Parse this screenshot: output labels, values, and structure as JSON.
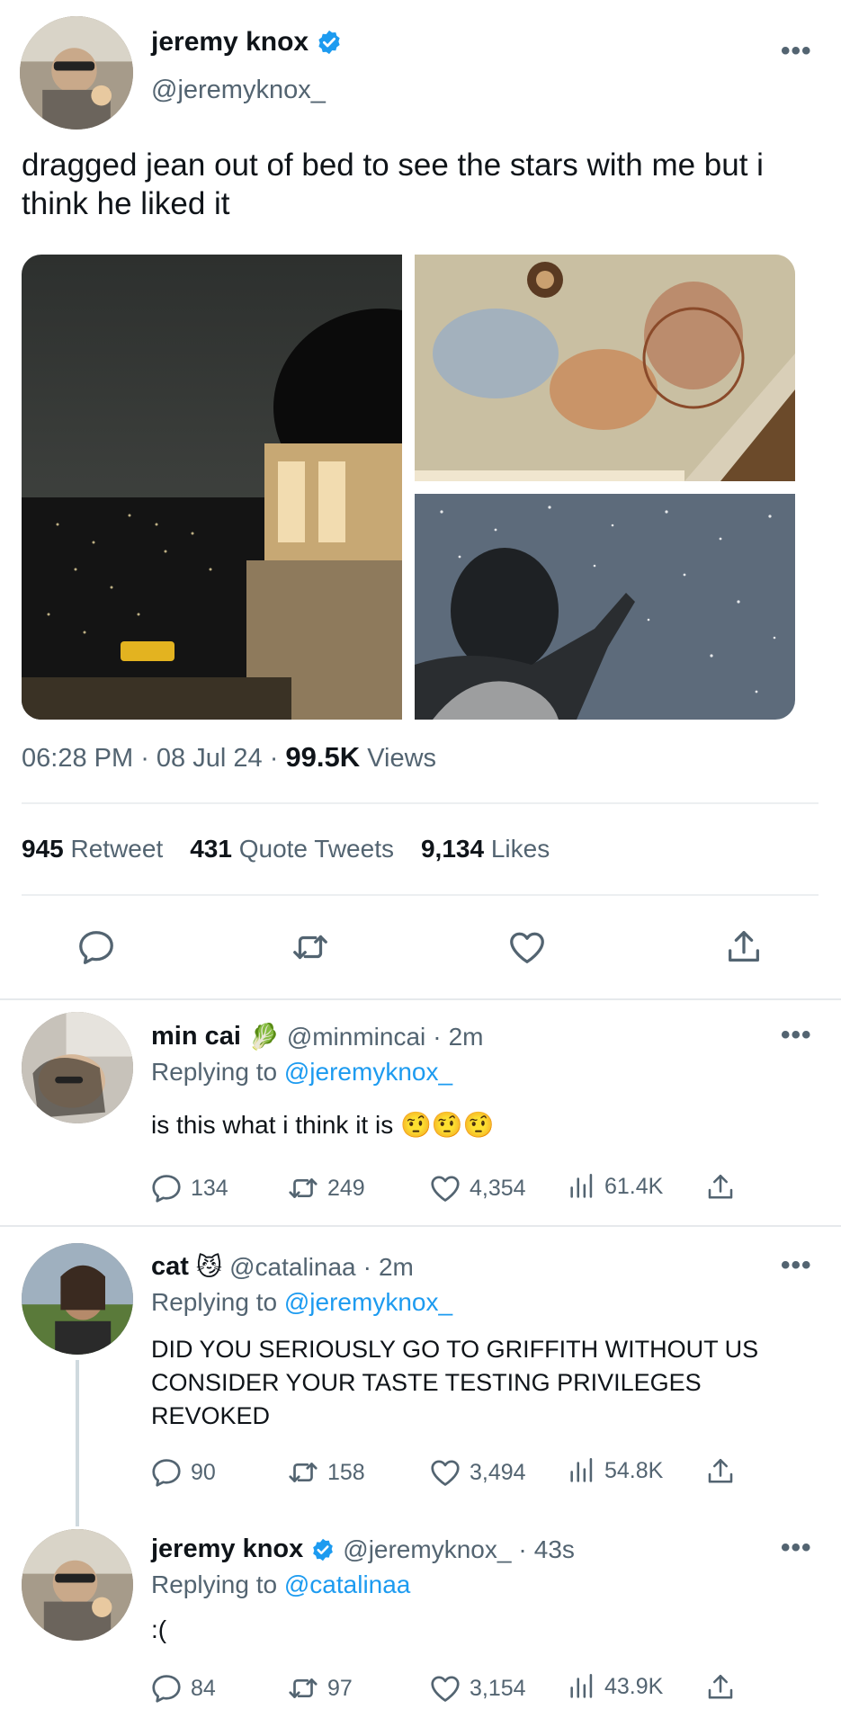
{
  "main_tweet": {
    "author_name": "jeremy knox",
    "author_handle": "@jeremyknox_",
    "text": "dragged jean out of bed to see the stars with me but i think he liked it",
    "time": "06:28 PM",
    "date": "08 Jul 24",
    "views_count": "99.5K",
    "views_label": "Views",
    "retweet_count": "945",
    "retweet_label": "Retweet",
    "quote_count": "431",
    "quote_label": "Quote Tweets",
    "like_count": "9,134",
    "like_label": "Likes"
  },
  "replies": [
    {
      "name": "min cai",
      "badge": "🥬",
      "handle": "@minmincai",
      "time": "2m",
      "replying_prefix": "Replying to",
      "replying_to": "@jeremyknox_",
      "text": "is this what i think it is 🤨🤨🤨",
      "replies": "134",
      "retweets": "249",
      "likes": "4,354",
      "views": "61.4K"
    },
    {
      "name": "cat",
      "badge": "😼",
      "handle": "@catalinaa",
      "time": "2m",
      "replying_prefix": "Replying to",
      "replying_to": "@jeremyknox_",
      "text": "DID YOU SERIOUSLY GO TO GRIFFITH WITHOUT US CONSIDER YOUR TASTE TESTING PRIVILEGES REVOKED",
      "replies": "90",
      "retweets": "158",
      "likes": "3,494",
      "views": "54.8K"
    },
    {
      "name": "jeremy knox",
      "handle": "@jeremyknox_",
      "time": "43s",
      "replying_prefix": "Replying to",
      "replying_to": "@catalinaa",
      "text": ":(",
      "replies": "84",
      "retweets": "97",
      "likes": "3,154",
      "views": "43.9K"
    }
  ],
  "colors": {
    "accent": "#1d9bf0",
    "muted": "#536471",
    "divider": "#e6e9ec"
  },
  "icons": [
    "verified-badge-icon",
    "more-icon",
    "reply-icon",
    "retweet-icon",
    "like-icon",
    "share-icon",
    "views-icon"
  ]
}
